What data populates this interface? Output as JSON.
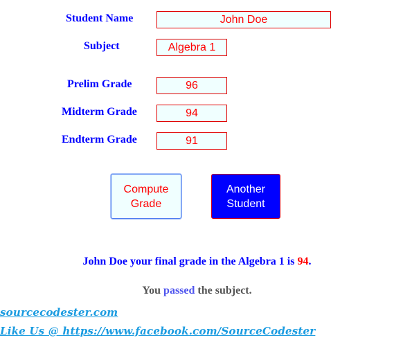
{
  "form": {
    "student_name": {
      "label": "Student Name",
      "value": "John Doe"
    },
    "subject": {
      "label": "Subject",
      "value": "Algebra 1"
    },
    "prelim": {
      "label": "Prelim Grade",
      "value": "96"
    },
    "midterm": {
      "label": "Midterm Grade",
      "value": "94"
    },
    "endterm": {
      "label": "Endterm Grade",
      "value": "91"
    }
  },
  "buttons": {
    "compute_line1": "Compute",
    "compute_line2": "Grade",
    "another_line1": "Another",
    "another_line2": "Student"
  },
  "result": {
    "prefix": "John Doe your final grade in the Algebra 1 is ",
    "final_grade": "94",
    "suffix": ".",
    "status_prefix": "You ",
    "status_word": "passed",
    "status_suffix": " the subject."
  },
  "footer": {
    "site_link": "sourcecodester.com",
    "facebook_link": "Like Us @ https://www.facebook.com/SourceCodester"
  },
  "colors": {
    "label": "#0000ff",
    "field_text": "#ff0000",
    "field_bg": "#f0ffff",
    "field_border": "#e00000",
    "primary_button_bg": "#0000ff",
    "grade_highlight": "#ff0000",
    "link": "#1a9be0"
  }
}
